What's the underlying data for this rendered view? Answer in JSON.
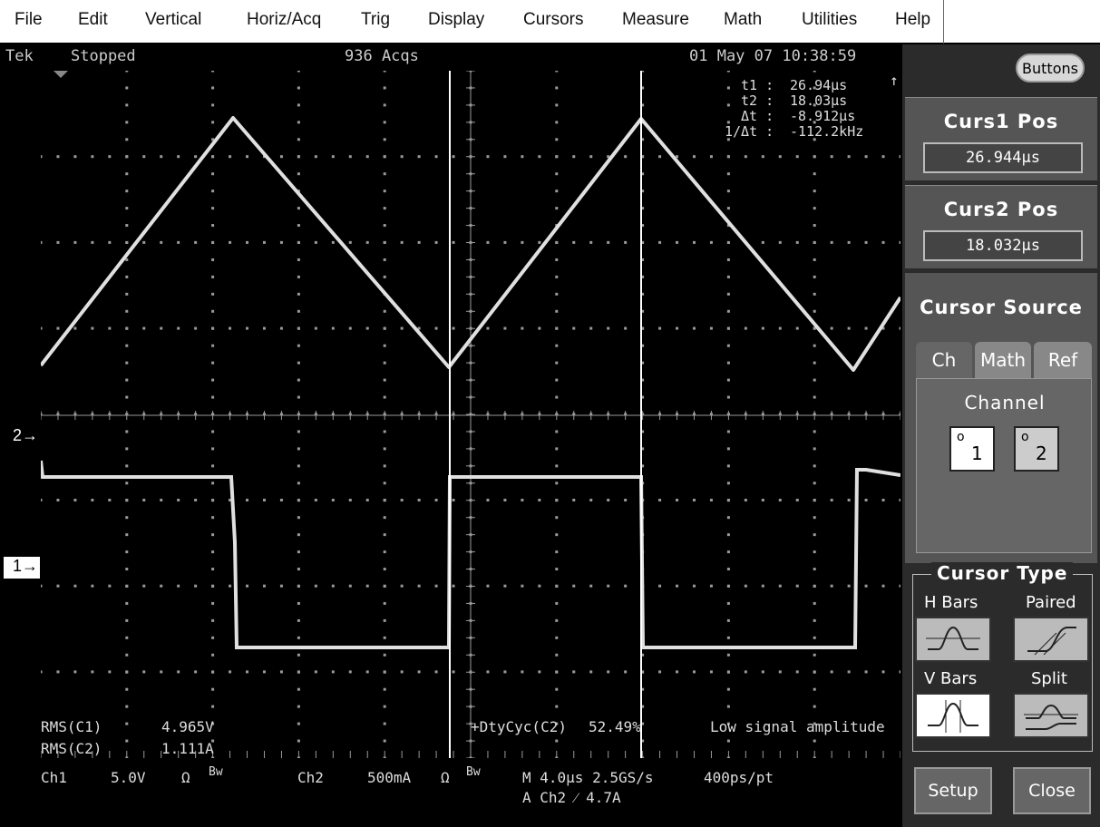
{
  "menu": [
    "File",
    "Edit",
    "Vertical",
    "Horiz/Acq",
    "Trig",
    "Display",
    "Cursors",
    "Measure",
    "Math",
    "Utilities",
    "Help"
  ],
  "status": {
    "brand": "Tek",
    "state": "Stopped",
    "acqs": "936 Acqs",
    "datetime": "01 May 07 10:38:59"
  },
  "cursor_readout": {
    "t1_label": "t1 :",
    "t1_value": "26.94µs",
    "t2_label": "t2 :",
    "t2_value": "18.03µs",
    "dt_label": "Δt :",
    "dt_value": "-8.912µs",
    "inv_label": "1/Δt :",
    "inv_value": "-112.2kHz"
  },
  "markers": {
    "ch2": "2",
    "ch1": "1"
  },
  "measurements": {
    "rms_c1_label": "RMS(C1)",
    "rms_c1_value": "4.965V",
    "rms_c2_label": "RMS(C2)",
    "rms_c2_value": "1.111A",
    "duty_label": "+DtyCyc(C2)",
    "duty_value": "52.49%",
    "warning": "Low signal amplitude"
  },
  "infobar": {
    "ch1": "Ch1",
    "ch1_scale": "5.0V",
    "ch1_coupling": "Ω",
    "ch2": "Ch2",
    "ch2_scale": "500mA",
    "ch2_coupling": "Ω",
    "bw": "Bw",
    "timebase": "M 4.0µs 2.5GS/s",
    "resolution": "400ps/pt",
    "trigger": "A Ch2 ⁄ 4.7A"
  },
  "panel": {
    "buttons_label": "Buttons",
    "curs1_title": "Curs1 Pos",
    "curs1_value": "26.944µs",
    "curs2_title": "Curs2 Pos",
    "curs2_value": "18.032µs",
    "source_title": "Cursor Source",
    "tabs": [
      "Ch",
      "Math",
      "Ref"
    ],
    "channel_label": "Channel",
    "channel_buttons": [
      "1",
      "2"
    ],
    "type_title": "Cursor Type",
    "type_hbars": "H Bars",
    "type_paired": "Paired",
    "type_vbars": "V Bars",
    "type_split": "Split",
    "setup": "Setup",
    "close": "Close"
  },
  "colors": {
    "trace": "#e0e0e0",
    "grid": "#9a9a9a",
    "cursor": "#ffffff",
    "panel": "#555555"
  }
}
